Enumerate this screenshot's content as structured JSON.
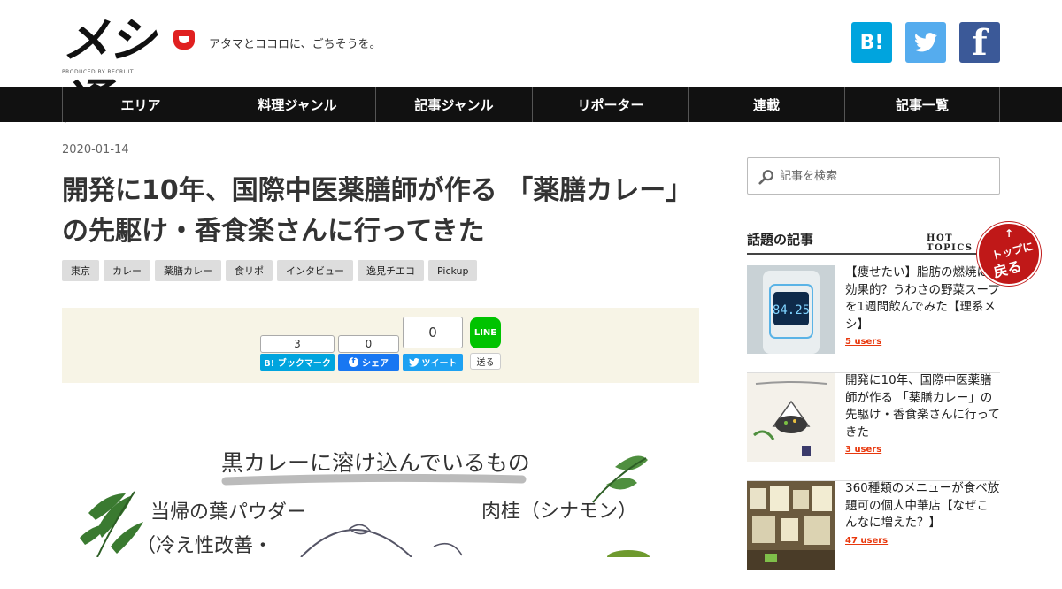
{
  "header": {
    "logo_text": "メシ通",
    "logo_sub": "PRODUCED BY RECRUIT",
    "tagline": "アタマとココロに、ごちそうを。",
    "social": [
      {
        "name": "hatena-bookmark-icon",
        "glyph": "B!"
      },
      {
        "name": "twitter-icon",
        "glyph": ""
      },
      {
        "name": "facebook-icon",
        "glyph": "f"
      }
    ]
  },
  "nav": {
    "items": [
      "エリア",
      "料理ジャンル",
      "記事ジャンル",
      "リポーター",
      "連載",
      "記事一覧"
    ]
  },
  "article": {
    "date": "2020-01-14",
    "title": "開発に10年、国際中医薬膳師が作る 「薬膳カレー」の先駆け・香食楽さんに行ってきた",
    "tags": [
      "東京",
      "カレー",
      "薬膳カレー",
      "食リポ",
      "インタビュー",
      "逸見チエコ",
      "Pickup"
    ]
  },
  "share": {
    "hatena": {
      "count": "3",
      "label": "B! ブックマーク"
    },
    "facebook": {
      "count": "0",
      "label": "シェア"
    },
    "twitter": {
      "count": "0",
      "label": "ツイート"
    },
    "line": {
      "icon": "LINE",
      "label": "送る"
    },
    "colors": {
      "hatena": "#00a4de",
      "facebook": "#1877f2",
      "twitter": "#1da1f2",
      "line": "#00c300"
    }
  },
  "illustration": {
    "heading": "黒カレーに溶け込んでいるもの",
    "left_label": "当帰の葉パウダー",
    "left_label_2": "（冷え性改善・",
    "right_label": "肉桂（シナモン）"
  },
  "sidebar": {
    "search_placeholder": "記事を検索",
    "popular_title": "話題の記事",
    "popular_sub": "HOT TOPICS",
    "items": [
      {
        "title": "【痩せたい】脂肪の燃焼に効果的？うわさの野菜スープを1週間飲んでみた【理系メシ】",
        "users": "5 users"
      },
      {
        "title": "開発に10年、国際中医薬膳師が作る 「薬膳カレー」の先駆け・香食楽さんに行ってきた",
        "users": "3 users"
      },
      {
        "title": "360種類のメニューが食べ放題可の個人中華店【なぜこんなに増えた？】",
        "users": "47 users"
      }
    ],
    "thumb1_display": "84.25"
  },
  "totop": {
    "arrow": "↑",
    "line1": "トップに",
    "line2": "戻る"
  }
}
